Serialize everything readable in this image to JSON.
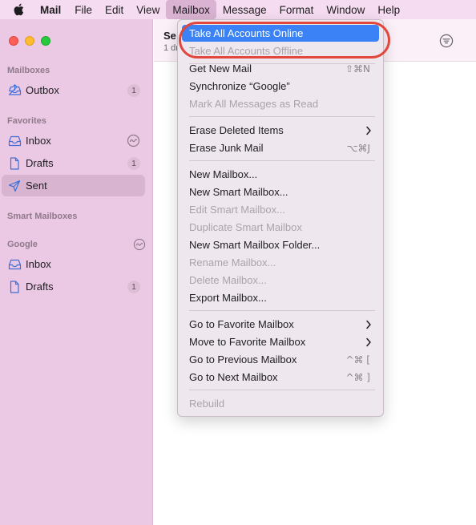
{
  "menubar": {
    "apple_icon": "apple-logo",
    "app": "Mail",
    "items": [
      "File",
      "Edit",
      "View",
      "Mailbox",
      "Message",
      "Format",
      "Window",
      "Help"
    ],
    "active": "Mailbox"
  },
  "sidebar": {
    "mailboxes_title": "Mailboxes",
    "outbox": {
      "label": "Outbox",
      "count": "1",
      "icon": "outbox-tray-icon"
    },
    "favorites_title": "Favorites",
    "fav_inbox": {
      "label": "Inbox",
      "icon": "inbox-tray-icon",
      "status": "activity-icon"
    },
    "fav_drafts": {
      "label": "Drafts",
      "count": "1",
      "icon": "document-icon"
    },
    "fav_sent": {
      "label": "Sent",
      "icon": "paper-plane-icon"
    },
    "smart_title": "Smart Mailboxes",
    "google_title": "Google",
    "google_inbox": {
      "label": "Inbox",
      "icon": "inbox-tray-icon"
    },
    "google_drafts": {
      "label": "Drafts",
      "count": "1",
      "icon": "document-icon"
    }
  },
  "main": {
    "title": "Se",
    "subtitle": "1 dr",
    "filter_icon": "filter-icon"
  },
  "mailbox_menu": {
    "take_online": "Take All Accounts Online",
    "take_offline": "Take All Accounts Offline",
    "get_new_mail": {
      "label": "Get New Mail",
      "shortcut": "⇧⌘N"
    },
    "sync_google": "Synchronize “Google”",
    "mark_all_read": "Mark All Messages as Read",
    "erase_deleted": "Erase Deleted Items",
    "erase_junk": {
      "label": "Erase Junk Mail",
      "shortcut": "⌥⌘J"
    },
    "new_mailbox": "New Mailbox...",
    "new_smart_mailbox": "New Smart Mailbox...",
    "edit_smart_mailbox": "Edit Smart Mailbox...",
    "duplicate_smart_mailbox": "Duplicate Smart Mailbox",
    "new_smart_folder": "New Smart Mailbox Folder...",
    "rename_mailbox": "Rename Mailbox...",
    "delete_mailbox": "Delete Mailbox...",
    "export_mailbox": "Export Mailbox...",
    "goto_favorite": "Go to Favorite Mailbox",
    "move_to_favorite": "Move to Favorite Mailbox",
    "goto_previous": {
      "label": "Go to Previous Mailbox",
      "shortcut": "^⌘ ["
    },
    "goto_next": {
      "label": "Go to Next Mailbox",
      "shortcut": "^⌘ ]"
    },
    "rebuild": "Rebuild"
  },
  "colors": {
    "highlight": "#3a82f5",
    "annotation": "#e2473e",
    "sidebar": "#ebc8e4",
    "menubar": "#f6dcf0"
  }
}
